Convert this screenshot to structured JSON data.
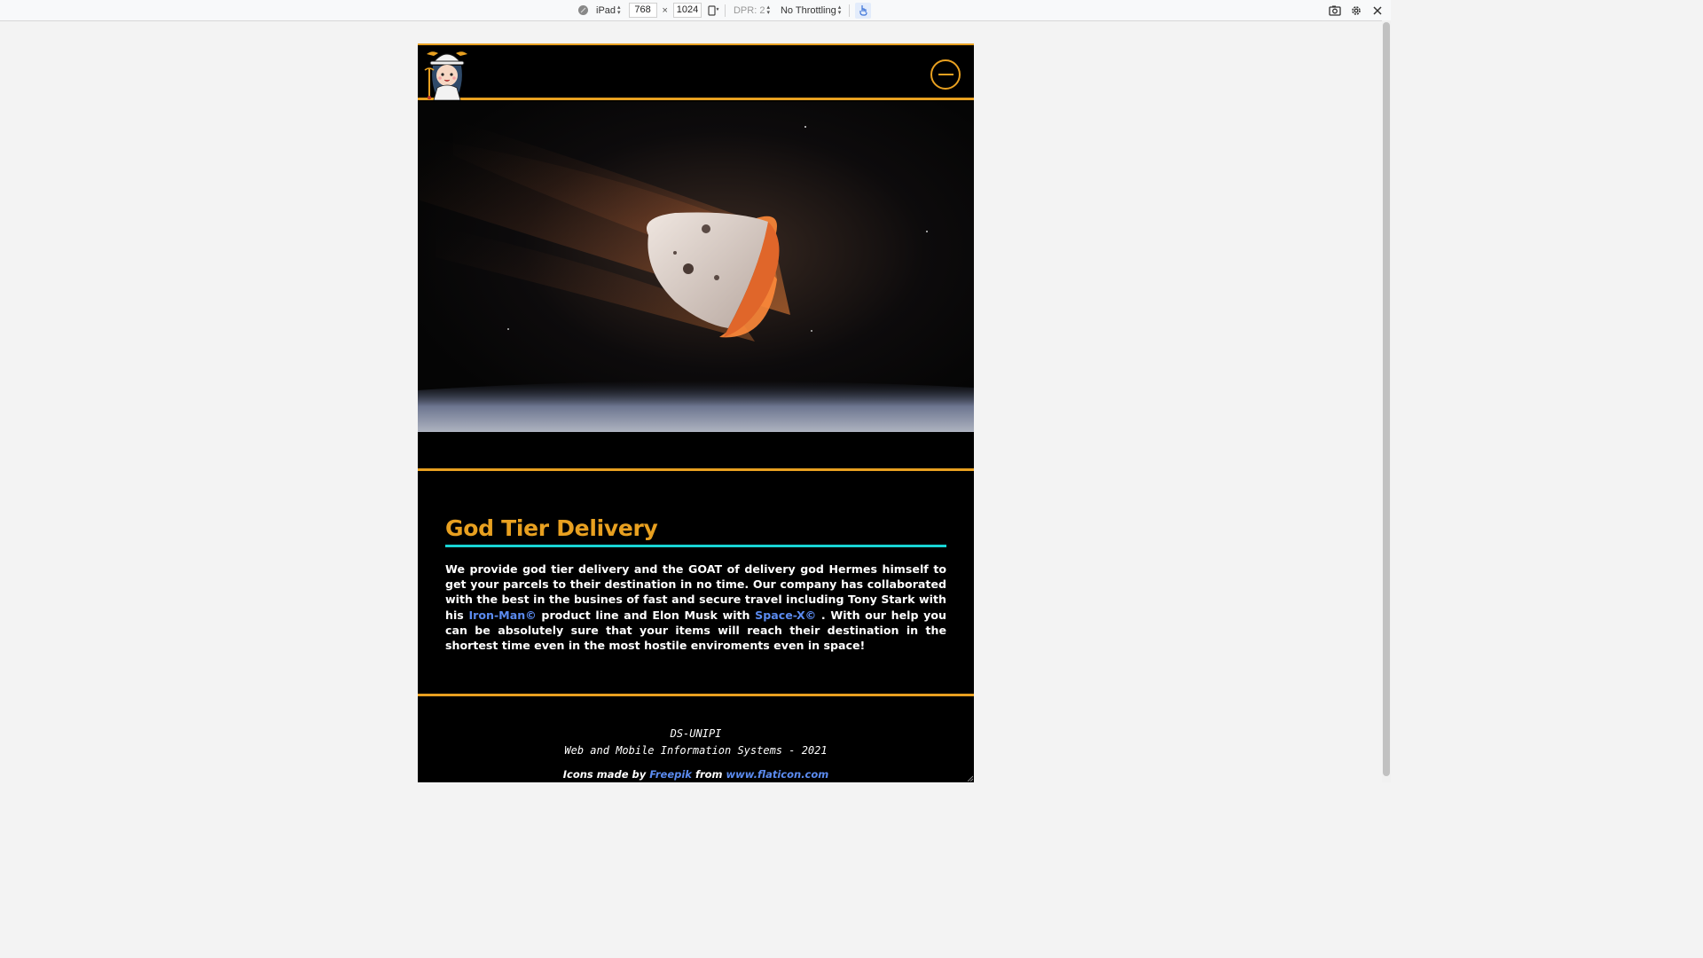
{
  "devtools": {
    "device": "iPad",
    "width": "768",
    "height": "1024",
    "dimension_separator": "×",
    "dpr": "DPR: 2",
    "throttling": "No Throttling"
  },
  "site": {
    "article": {
      "title": "God Tier Delivery",
      "text_1": "We provide god tier delivery and the GOAT of delivery god Hermes himself to get your parcels to their destination in no time. Our company has collaborated with the best in the busines of fast and secure travel including Tony Stark with his ",
      "link_ironman": "Iron-Man©",
      "text_2": " product line and Elon Musk with ",
      "link_spacex": "Space-X©",
      "text_3": " . With our help you can be absolutely sure that your items will reach their destination in the shortest time even in the most hostile enviroments even in space!"
    },
    "footer": {
      "line1": "DS-UNIPI",
      "line2": "Web and Mobile Information Systems - 2021",
      "credit_prefix": "Icons made by ",
      "credit_author": "Freepik",
      "credit_middle": " from ",
      "credit_site": "www.flaticon.com"
    }
  },
  "colors": {
    "accent": "#e8a020",
    "title_underline": "#18d4d4",
    "link": "#5b8bf0",
    "page_bg": "#000000"
  },
  "icons": [
    "device-emulation-icon",
    "rotate-icon",
    "touch-icon",
    "screenshot-icon",
    "settings-gear-icon",
    "close-icon",
    "hermes-logo-icon",
    "menu-icon"
  ]
}
